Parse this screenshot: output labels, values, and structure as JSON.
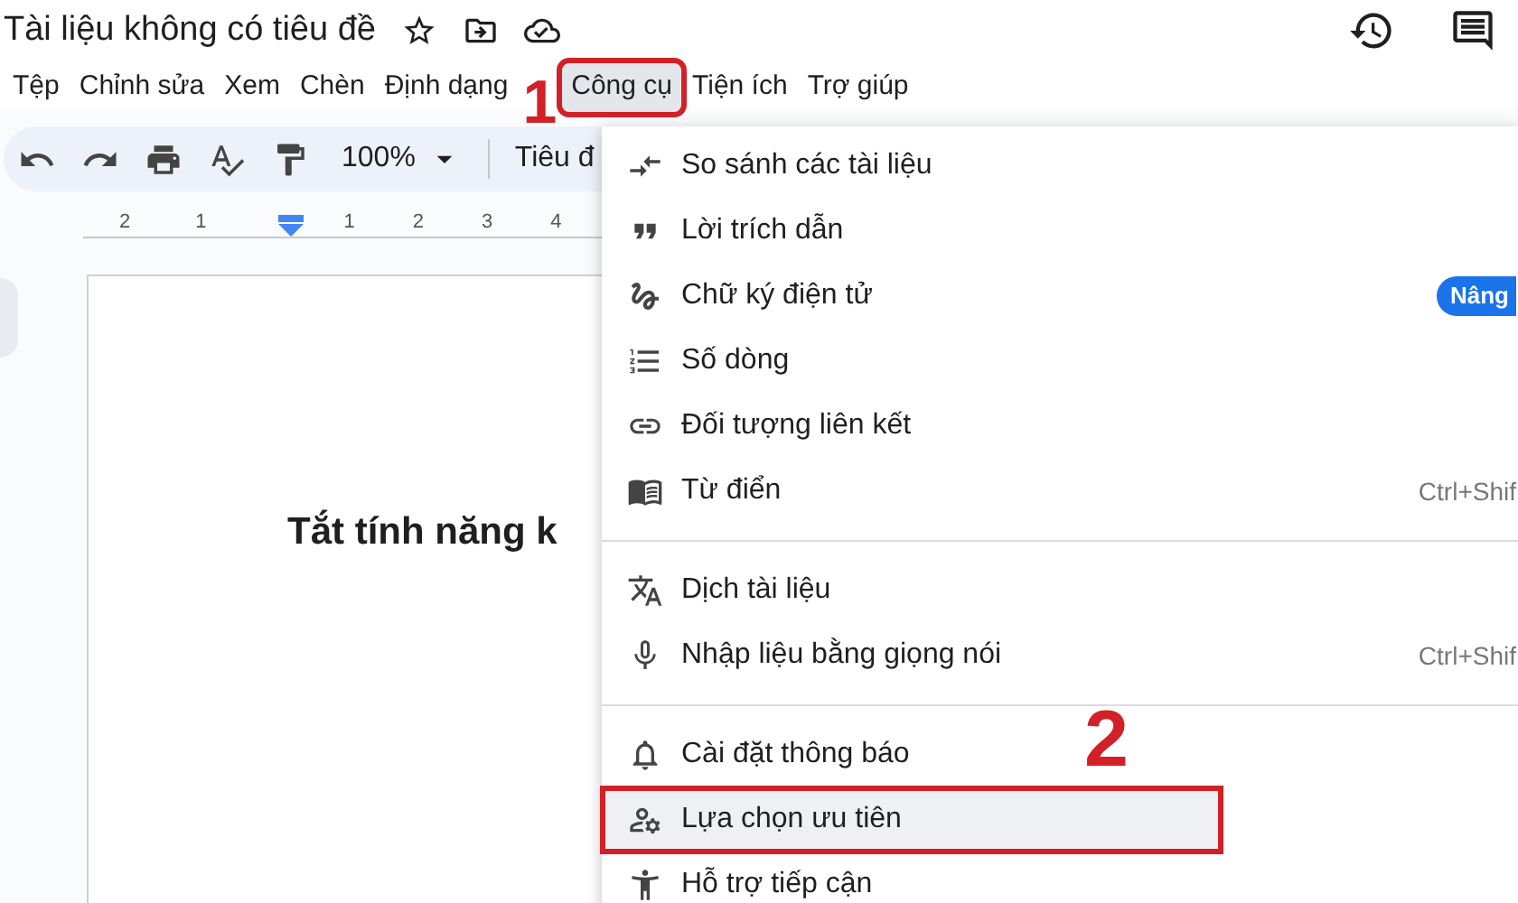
{
  "document_title": "Tài liệu không có tiêu đề",
  "menu_bar": [
    {
      "label": "Tệp",
      "selected": false
    },
    {
      "label": "Chỉnh sửa",
      "selected": false
    },
    {
      "label": "Xem",
      "selected": false
    },
    {
      "label": "Chèn",
      "selected": false
    },
    {
      "label": "Định dạng",
      "selected": false
    },
    {
      "label": "Công cụ",
      "selected": true
    },
    {
      "label": "Tiện ích",
      "selected": false
    },
    {
      "label": "Trợ giúp",
      "selected": false
    }
  ],
  "toolbar": {
    "zoom": "100%",
    "style": "Tiêu đ"
  },
  "ruler": [
    "2",
    "1",
    "1",
    "2",
    "3",
    "4"
  ],
  "document_text": "Tắt tính năng k",
  "tools_menu": [
    [
      {
        "label": "So sánh các tài liệu",
        "selected": false
      },
      {
        "label": "Lời trích dẫn",
        "selected": false
      },
      {
        "label": "Chữ ký điện tử",
        "badge": "Nâng",
        "selected": false
      },
      {
        "label": "Số dòng",
        "selected": false
      },
      {
        "label": "Đối tượng liên kết",
        "selected": false
      },
      {
        "label": "Từ điển",
        "shortcut": "Ctrl+Shif",
        "selected": false
      }
    ],
    [
      {
        "label": "Dịch tài liệu",
        "selected": false
      },
      {
        "label": "Nhập liệu bằng giọng nói",
        "shortcut": "Ctrl+Shif",
        "selected": false
      }
    ],
    [
      {
        "label": "Cài đặt thông báo",
        "selected": false
      },
      {
        "label": "Lựa chọn ưu tiên",
        "selected": true
      },
      {
        "label": "Hỗ trợ tiếp cận",
        "selected": false
      }
    ]
  ],
  "callouts": [
    "1",
    "2"
  ]
}
